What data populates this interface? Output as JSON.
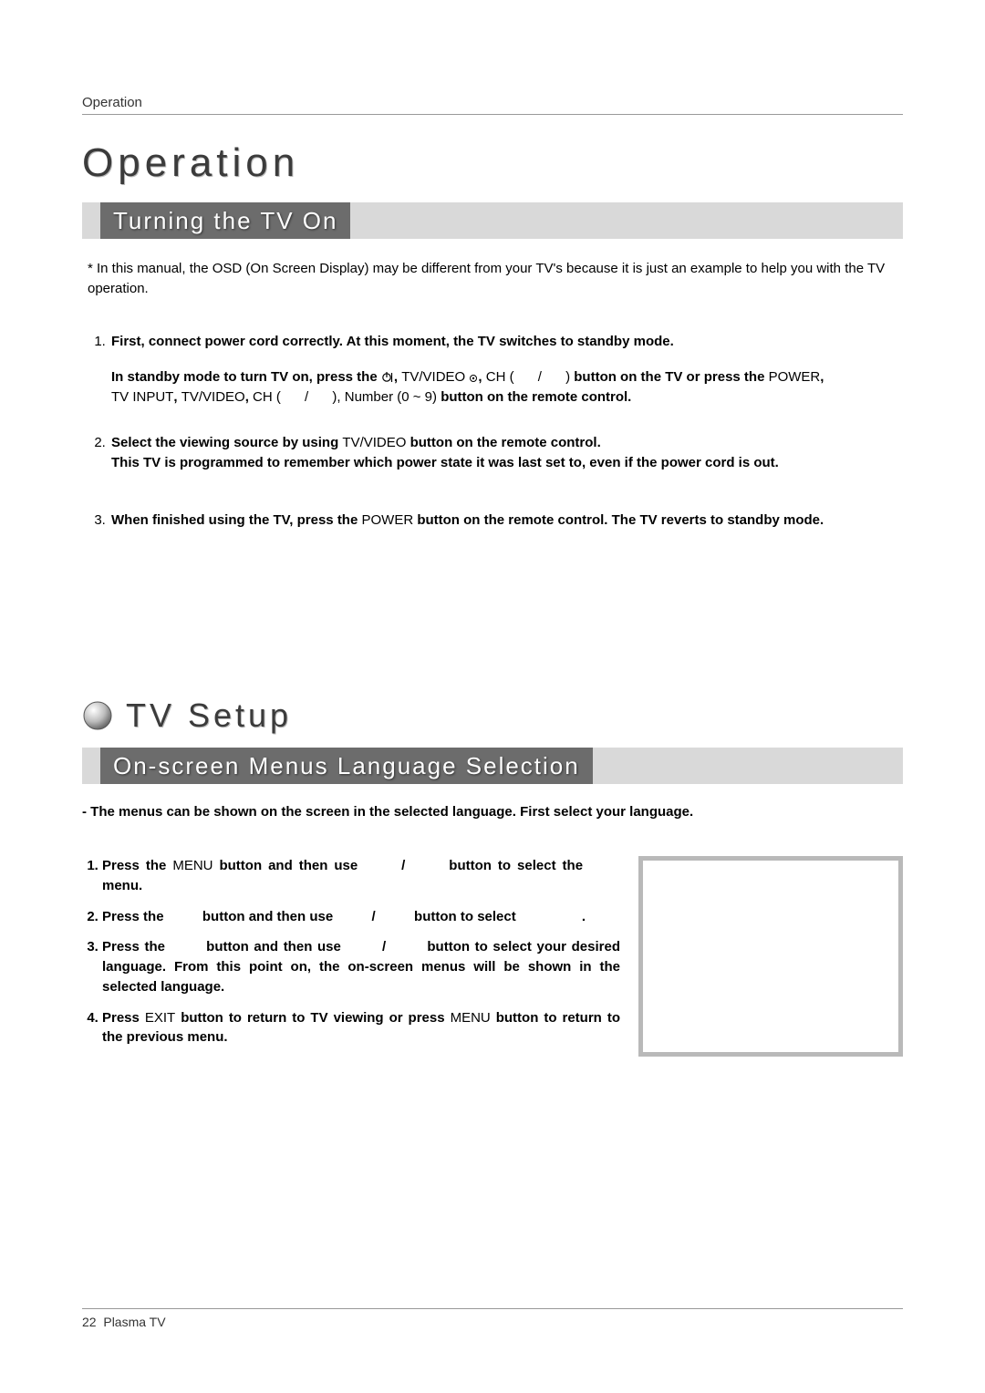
{
  "header": "Operation",
  "main_title": "Operation",
  "band1": "Turning the TV On",
  "osd_note": "* In this manual, the OSD (On Screen Display) may be different from your TV's because it is just an example to help you with the TV operation.",
  "step1_a": "First, connect power cord correctly. At this moment, the TV switches to standby mode.",
  "step1_b1": "In standby mode to turn TV on, press the ",
  "step1_b2": ", ",
  "step1_b_tvvideo": "TV/VIDEO ",
  "step1_b3": ", ",
  "step1_b_ch": "CH (",
  "step1_b_sep": " / ",
  "step1_b_close": ") ",
  "step1_b4": "button on the TV or press the ",
  "step1_b_power": "POWER",
  "step1_b_comma": ", ",
  "step1_c_tvinput": "TV INPUT",
  "step1_c1": ", ",
  "step1_c_tvvideo": "TV/VIDEO",
  "step1_c2": ", ",
  "step1_c_ch": "CH (",
  "step1_c_sep": " / ",
  "step1_c_close": "), ",
  "step1_c_number": "Number (0 ~ 9) ",
  "step1_c_tail": "button on the remote control.",
  "step2_a": "Select the viewing source by using ",
  "step2_tvvideo": "TV/VIDEO",
  "step2_b": " button on the remote control.",
  "step2_line2": "This TV is programmed to remember which power state it was last set to, even if the power cord is out.",
  "step3_a": "When finished using the TV, press the ",
  "step3_power": "POWER",
  "step3_b": " button on the remote control. The TV reverts to standby mode.",
  "setup_title": "TV Setup",
  "band2": "On-screen Menus Language Selection",
  "lang_note": "- The menus can be shown on the screen in the selected language. First select your language.",
  "l1_a": "Press the ",
  "l1_menu": "MENU",
  "l1_b": " button and then use ",
  "l1_sep": " / ",
  "l1_c": " button to select the ",
  "l1_tail": "menu.",
  "l2_a": "Press the ",
  "l2_b": " button and then use ",
  "l2_sep": " / ",
  "l2_c": " button to select ",
  "l2_tail": ".",
  "l3_a": "Press the ",
  "l3_b": " button and then use ",
  "l3_sep": " / ",
  "l3_c": " button to select your desired language. From this point on, the on-screen menus will be shown in the selected language.",
  "l4_a": "Press ",
  "l4_exit": "EXIT",
  "l4_b": " button to return to TV viewing or press ",
  "l4_menu": "MENU",
  "l4_c": " button to return to the previous menu.",
  "footer_page": "22",
  "footer_label": "Plasma TV"
}
